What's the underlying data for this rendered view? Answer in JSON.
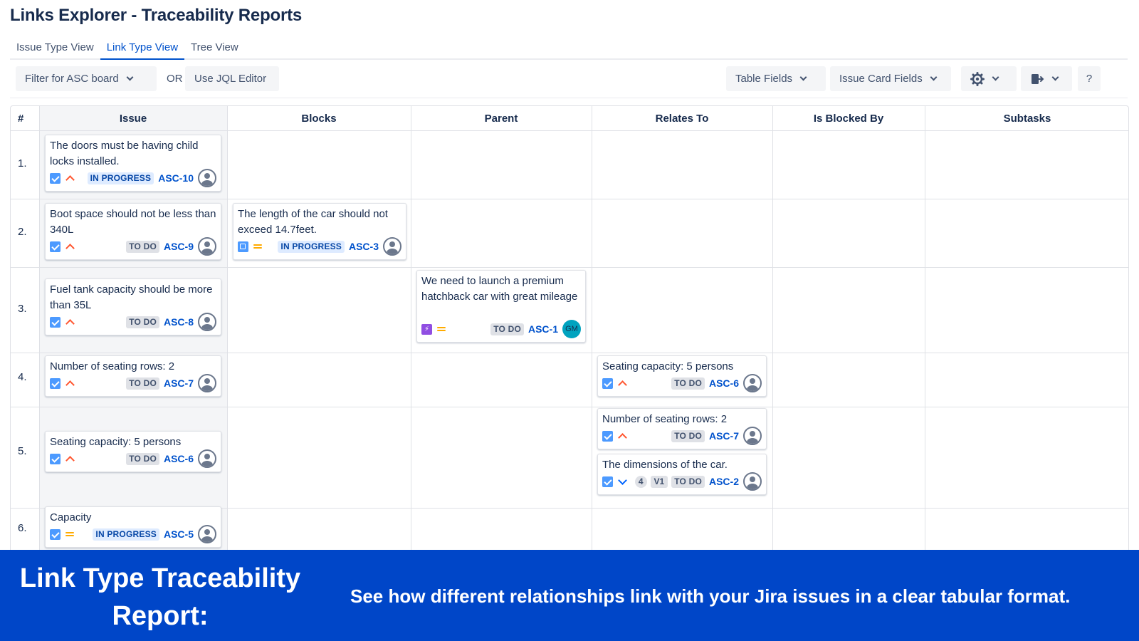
{
  "app": {
    "title": "Links Explorer - Traceability Reports"
  },
  "tabs": [
    {
      "label": "Issue Type View",
      "active": false
    },
    {
      "label": "Link Type View",
      "active": true
    },
    {
      "label": "Tree View",
      "active": false
    }
  ],
  "toolbar": {
    "filter_label": "Filter for ASC board",
    "or_label": "OR",
    "jql_label": "Use JQL Editor",
    "table_fields_label": "Table Fields",
    "card_fields_label": "Issue Card Fields",
    "settings_icon": "gear-icon",
    "export_icon": "export-icon",
    "help_label": "?"
  },
  "table": {
    "columns": [
      "#",
      "Issue",
      "Blocks",
      "Parent",
      "Relates To",
      "Is Blocked By",
      "Subtasks"
    ],
    "rows": [
      {
        "num": "1.",
        "issue": {
          "summary": "The doors must be having child locks installed.",
          "status": "IN PROGRESS",
          "key": "ASC-10"
        }
      },
      {
        "num": "2.",
        "issue": {
          "summary": "Boot space should not be less than 340L",
          "status": "TO DO",
          "key": "ASC-9"
        },
        "blocks": [
          {
            "summary": "The length of the car should not exceed 14.7feet.",
            "status": "IN PROGRESS",
            "key": "ASC-3"
          }
        ]
      },
      {
        "num": "3.",
        "issue": {
          "summary": "Fuel tank capacity should be more than 35L",
          "status": "TO DO",
          "key": "ASC-8"
        },
        "parent": [
          {
            "summary": "We need to launch a premium hatchback car with great mileage",
            "status": "TO DO",
            "key": "ASC-1",
            "avatar": "GM"
          }
        ]
      },
      {
        "num": "4.",
        "issue": {
          "summary": "Number of seating rows: 2",
          "status": "TO DO",
          "key": "ASC-7"
        },
        "relates_to": [
          {
            "summary": "Seating capacity: 5 persons",
            "status": "TO DO",
            "key": "ASC-6"
          }
        ]
      },
      {
        "num": "5.",
        "issue": {
          "summary": "Seating capacity: 5 persons",
          "status": "TO DO",
          "key": "ASC-6"
        },
        "relates_to": [
          {
            "summary": "Number of seating rows: 2",
            "status": "TO DO",
            "key": "ASC-7"
          },
          {
            "summary": "The dimensions of the car.",
            "estimate": "4",
            "version": "V1",
            "status": "TO DO",
            "key": "ASC-2"
          }
        ]
      },
      {
        "num": "6.",
        "issue": {
          "summary": "Capacity",
          "status": "IN PROGRESS",
          "key": "ASC-5"
        }
      }
    ]
  },
  "banner": {
    "title": "Link Type Traceability Report:",
    "description": "See how different relationships link with your Jira issues in a clear tabular format."
  },
  "colors": {
    "accent": "#0052cc",
    "banner": "#0046c8",
    "in_progress": "#0747a6"
  }
}
